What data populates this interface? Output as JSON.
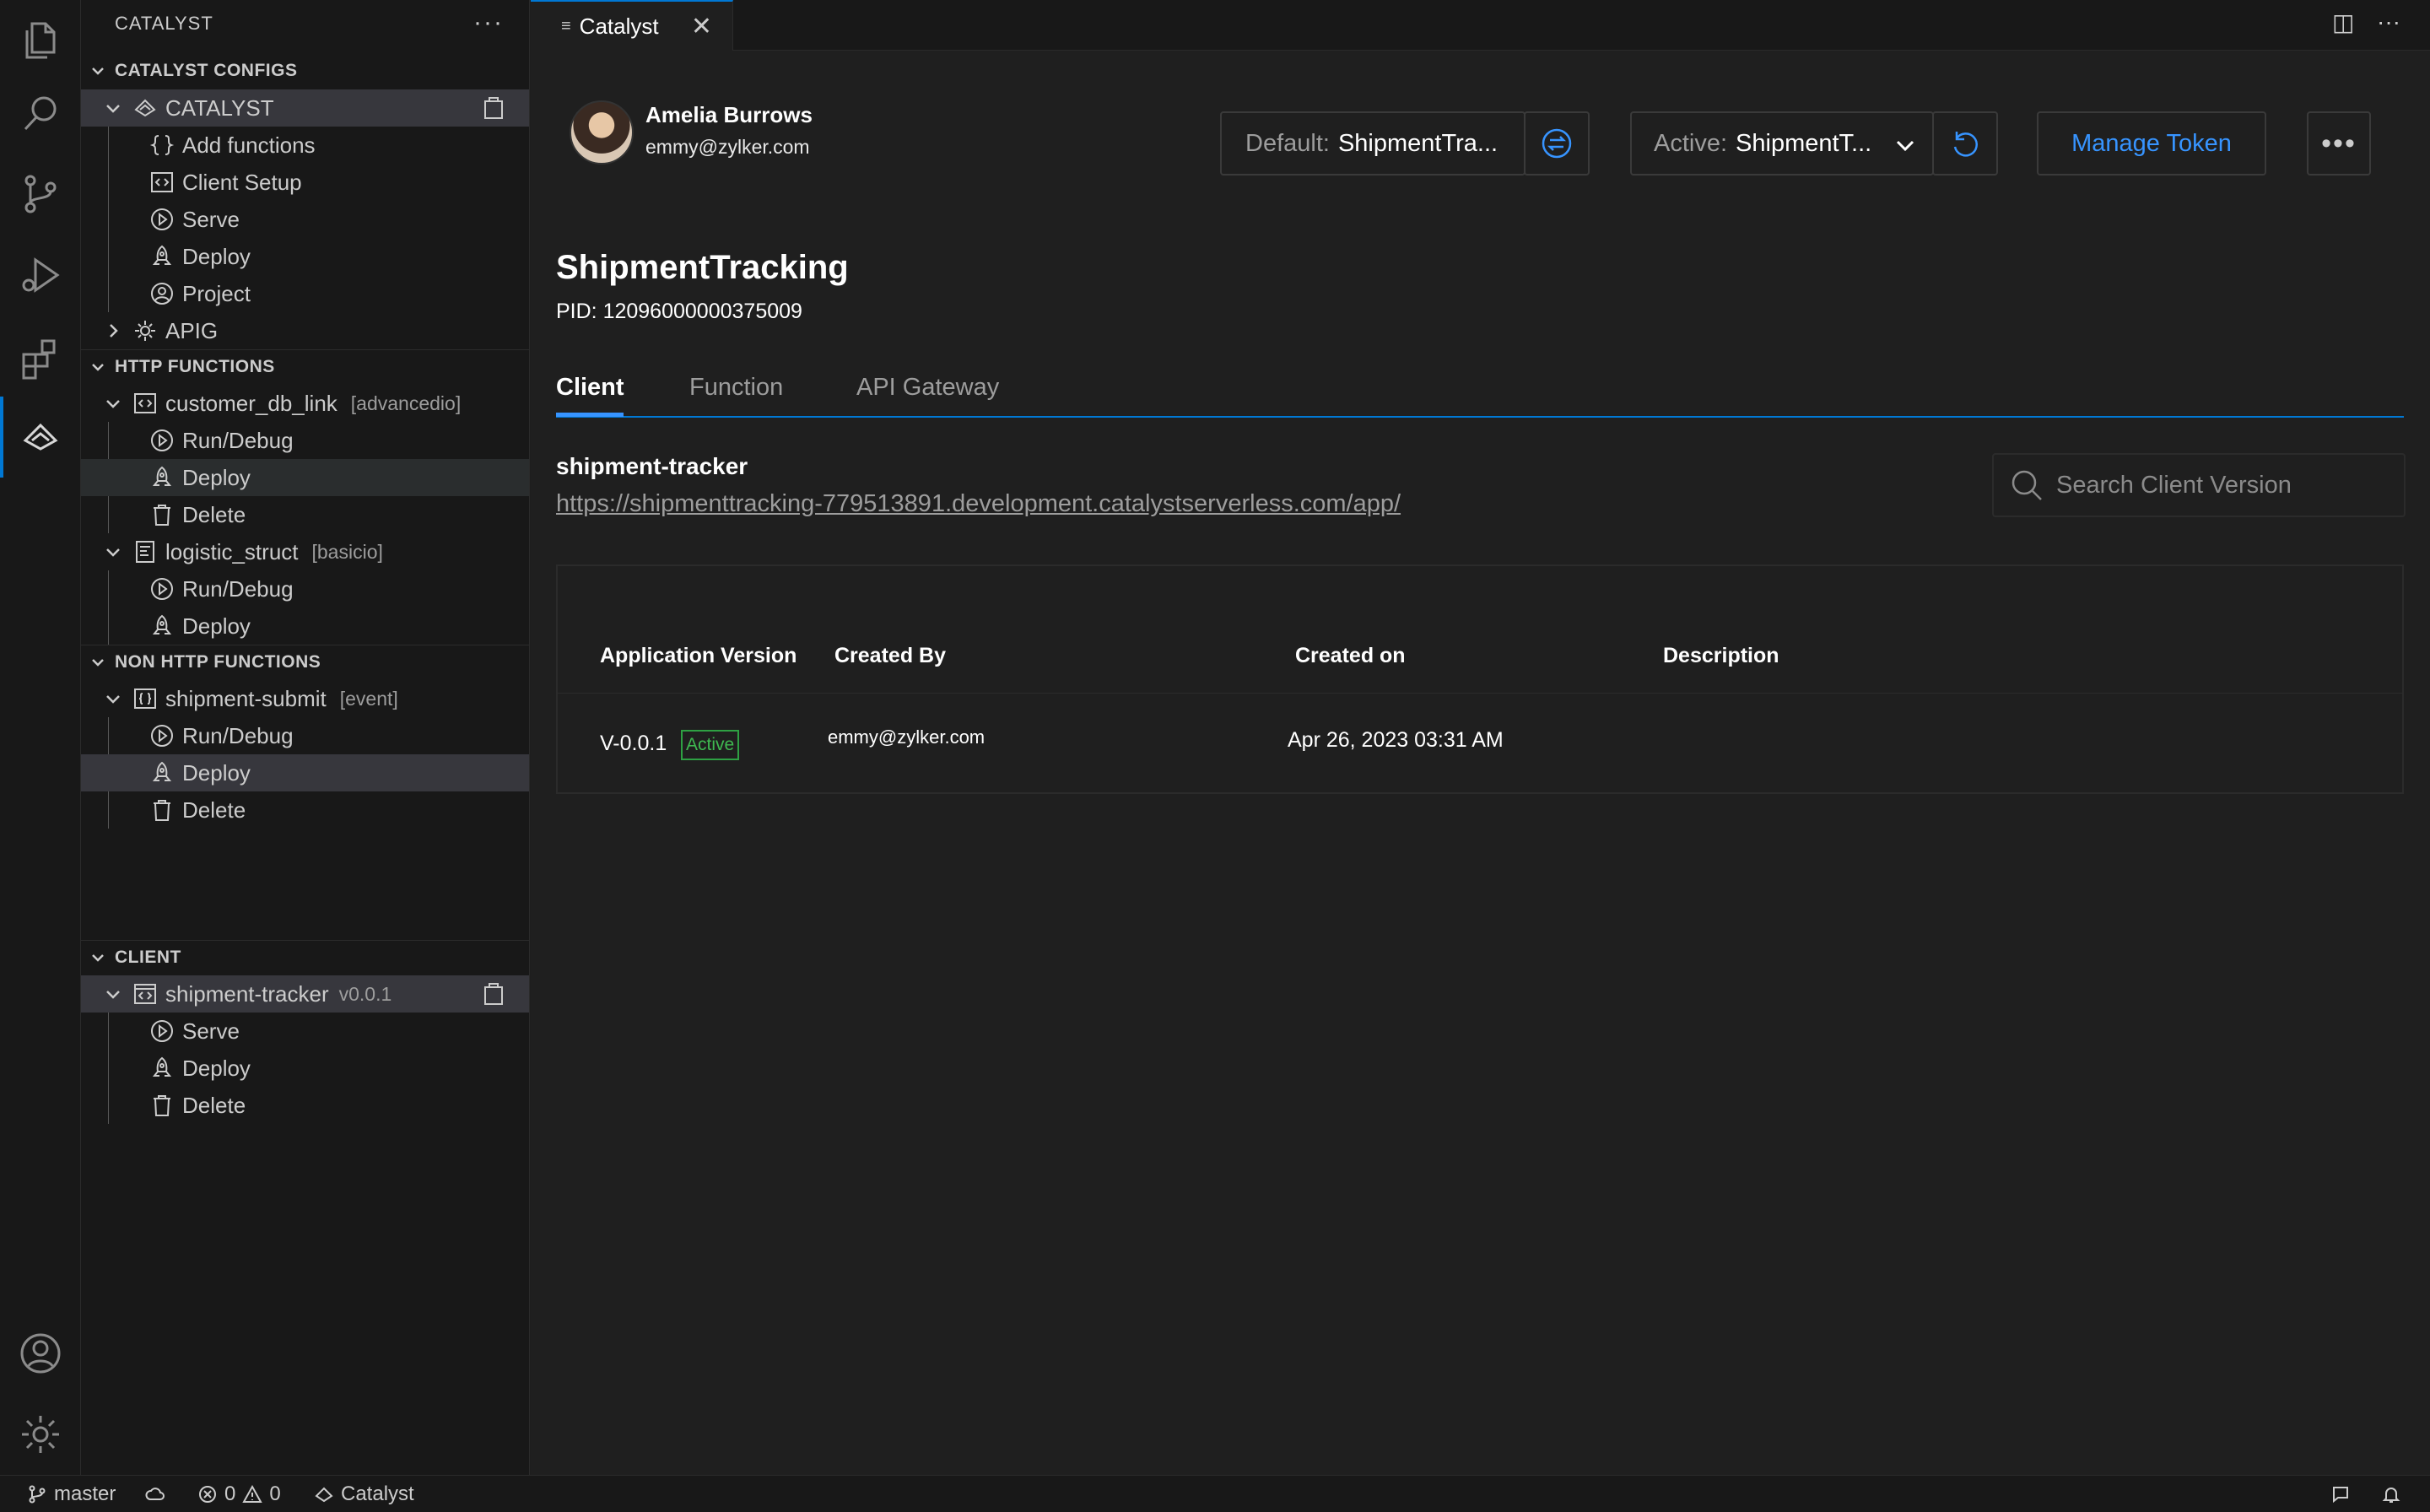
{
  "sidebar": {
    "title": "CATALYST",
    "more": "···",
    "sections": {
      "configs": "CATALYST CONFIGS",
      "http": "HTTP FUNCTIONS",
      "nonhttp": "NON HTTP FUNCTIONS",
      "client": "CLIENT"
    },
    "configs": {
      "root": "CATALYST",
      "items": [
        "Add functions",
        "Client Setup",
        "Serve",
        "Deploy",
        "Project"
      ],
      "apig": "APIG"
    },
    "http": {
      "fn1": {
        "name": "customer_db_link",
        "tag": "[advancedio]",
        "items": [
          "Run/Debug",
          "Deploy",
          "Delete"
        ]
      },
      "fn2": {
        "name": "logistic_struct",
        "tag": "[basicio]",
        "items": [
          "Run/Debug",
          "Deploy"
        ]
      }
    },
    "nonhttp": {
      "fn1": {
        "name": "shipment-submit",
        "tag": "[event]",
        "items": [
          "Run/Debug",
          "Deploy",
          "Delete"
        ]
      }
    },
    "client": {
      "name": "shipment-tracker",
      "version": "v0.0.1",
      "items": [
        "Serve",
        "Deploy",
        "Delete"
      ]
    }
  },
  "editor": {
    "tab_label": "Catalyst",
    "tab_icon": "≡",
    "close": "✕",
    "split": "◫",
    "more": "···"
  },
  "user": {
    "name": "Amelia Burrows",
    "email": "emmy@zylker.com"
  },
  "controls": {
    "default_label": "Default:",
    "default_value": "ShipmentTra...",
    "active_label": "Active:",
    "active_value": "ShipmentT...",
    "manage_token": "Manage Token",
    "more": "•••"
  },
  "project": {
    "title": "ShipmentTracking",
    "pid": "PID: 12096000000375009"
  },
  "tabs": [
    "Client",
    "Function",
    "API Gateway"
  ],
  "client": {
    "app_name": "shipment-tracker",
    "url": "https://shipmenttracking-779513891.development.catalystserverless.com/app/",
    "search_placeholder": "Search Client Version"
  },
  "table": {
    "headers": [
      "Application Version",
      "Created By",
      "Created on",
      "Description"
    ],
    "rows": [
      {
        "version": "V-0.0.1",
        "badge": "Active",
        "created_by": "emmy@zylker.com",
        "created_on": "Apr 26, 2023 03:31 AM",
        "description": ""
      }
    ]
  },
  "status": {
    "branch": "master",
    "errors": "0",
    "warnings": "0",
    "extension": "Catalyst"
  },
  "colors": {
    "accent": "#3794ff",
    "active_badge": "#3fb950",
    "background": "#1f1f1f"
  }
}
